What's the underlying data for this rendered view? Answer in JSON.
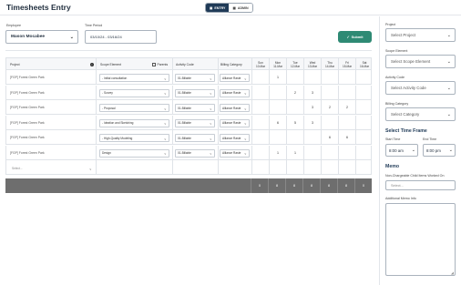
{
  "header": {
    "title": "Timesheets Entry",
    "views": [
      {
        "label": "ENTRY",
        "icon": "calendar-icon",
        "active": true
      },
      {
        "label": "ADMIN",
        "icon": "grid-icon",
        "active": false
      }
    ]
  },
  "filters": {
    "employee_label": "Employee",
    "employee_value": "Mason Mocabee",
    "period_label": "Time Period",
    "period_value": "03/10/24 - 03/16/24",
    "submit_label": "Submit"
  },
  "grid": {
    "columns": {
      "project": "Project",
      "scope": "Scope Element",
      "parents": "Parents",
      "activity": "Activity Code",
      "billing": "Billing Category"
    },
    "days": [
      {
        "dow": "Sun",
        "date": "10-Mar"
      },
      {
        "dow": "Mon",
        "date": "11-Mar"
      },
      {
        "dow": "Tue",
        "date": "12-Mar"
      },
      {
        "dow": "Wed",
        "date": "13-Mar"
      },
      {
        "dow": "Thu",
        "date": "14-Mar"
      },
      {
        "dow": "Fri",
        "date": "15-Mar"
      },
      {
        "dow": "Sat",
        "date": "16-Mar"
      }
    ],
    "rows": [
      {
        "project": "[FGP] Forest Green Park",
        "scope": "- Initial consultation",
        "activity": "01-Billable",
        "billing": "Alliance Raste",
        "hours": [
          "",
          "1",
          "",
          "",
          "",
          "",
          ""
        ]
      },
      {
        "project": "[FGP] Forest Green Park",
        "scope": "- Survey",
        "activity": "01-Billable",
        "billing": "Alliance Raste",
        "hours": [
          "",
          "",
          "2",
          "3",
          "",
          "",
          ""
        ]
      },
      {
        "project": "[FGP] Forest Green Park",
        "scope": "- Proposal",
        "activity": "01-Billable",
        "billing": "Alliance Raste",
        "hours": [
          "",
          "",
          "",
          "3",
          "2",
          "2",
          ""
        ]
      },
      {
        "project": "[FGP] Forest Green Park",
        "scope": "- Ideation and Sketching",
        "activity": "01-Billable",
        "billing": "Alliance Raste",
        "hours": [
          "",
          "6",
          "5",
          "3",
          "",
          "",
          ""
        ]
      },
      {
        "project": "[FGP] Forest Green Park",
        "scope": "- High-Quality Modeling",
        "activity": "01-Billable",
        "billing": "Alliance Raste",
        "hours": [
          "",
          "",
          "",
          "",
          "6",
          "6",
          ""
        ]
      },
      {
        "project": "[FGP] Forest Green Park",
        "scope": "Design",
        "activity": "01-Billable",
        "billing": "Alliance Raste",
        "hours": [
          "",
          "1",
          "1",
          "",
          "",
          "",
          ""
        ]
      }
    ],
    "new_row_placeholder": "Select...",
    "totals": [
      "0",
      "8",
      "8",
      "8",
      "8",
      "8",
      "0"
    ]
  },
  "side": {
    "project_label": "Project",
    "project_placeholder": "Select Project",
    "scope_label": "Scope Element",
    "scope_placeholder": "Select Scope Element",
    "activity_label": "Activity Code",
    "activity_placeholder": "Select Activity Code",
    "category_label": "Billing Category",
    "category_placeholder": "Select Category",
    "timeframe_heading": "Select Time Frame",
    "start_label": "Start Time",
    "start_value": "8:00 am",
    "end_label": "End Time",
    "end_value": "8:00 pm",
    "memo_heading": "Memo",
    "nonchargeable_label": "Non-Chargeable Child Items Worked On",
    "nonchargeable_placeholder": "Select...",
    "additional_label": "Additional Memo Info"
  },
  "colors": {
    "accent": "#2e8a74",
    "nav": "#1f3a57",
    "totals_bar": "#6e6e6e"
  }
}
